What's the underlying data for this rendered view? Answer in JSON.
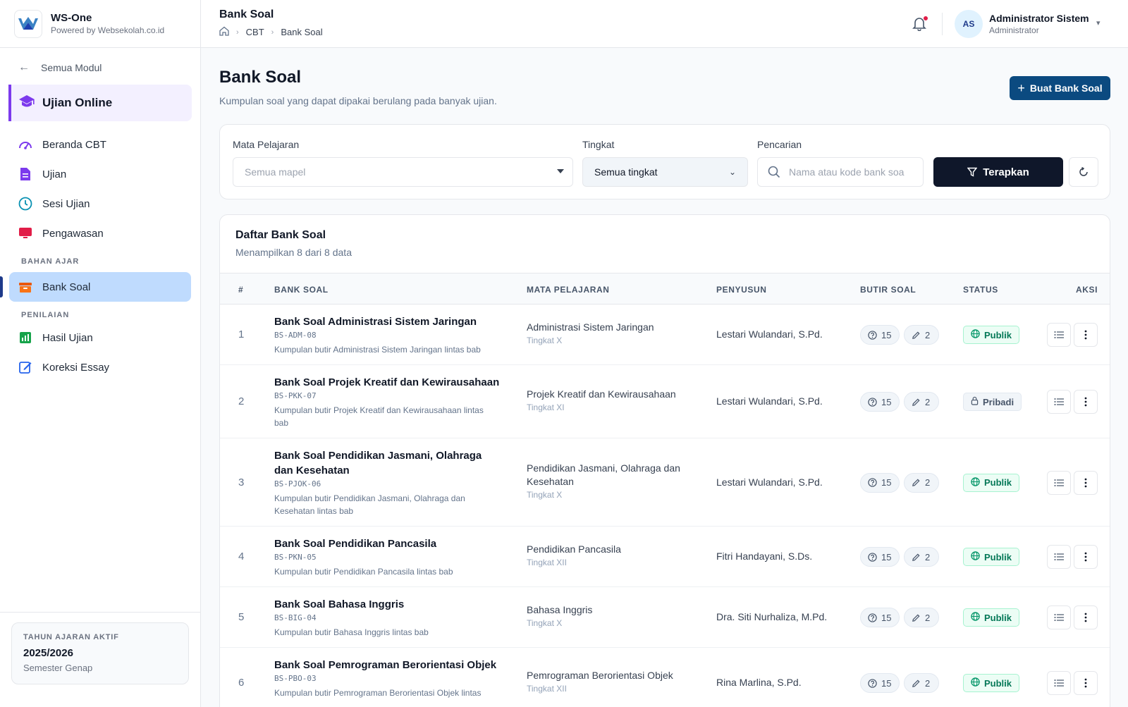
{
  "brand": {
    "name": "WS-One",
    "sub": "Powered by Websekolah.co.id"
  },
  "sidebar": {
    "back_label": "Semua Modul",
    "module_label": "Ujian Online",
    "items": [
      {
        "label": "Beranda CBT",
        "icon": "dashboard-icon"
      },
      {
        "label": "Ujian",
        "icon": "document-icon"
      },
      {
        "label": "Sesi Ujian",
        "icon": "clock-icon"
      },
      {
        "label": "Pengawasan",
        "icon": "monitor-icon"
      }
    ],
    "section_bahan": "BAHAN AJAR",
    "bank_soal_label": "Bank Soal",
    "section_penilaian": "PENILAIAN",
    "penilaian_items": [
      {
        "label": "Hasil Ujian",
        "icon": "chart-icon"
      },
      {
        "label": "Koreksi Essay",
        "icon": "edit-icon"
      }
    ],
    "footer": {
      "label": "TAHUN AJARAN AKTIF",
      "year": "2025/2026",
      "semester": "Semester Genap"
    }
  },
  "topbar": {
    "title": "Bank Soal",
    "breadcrumb": [
      "CBT",
      "Bank Soal"
    ],
    "user": {
      "initials": "AS",
      "name": "Administrator Sistem",
      "role": "Administrator"
    }
  },
  "page": {
    "title": "Bank Soal",
    "subtitle": "Kumpulan soal yang dapat dipakai berulang pada banyak ujian.",
    "create_label": "Buat Bank Soal"
  },
  "filters": {
    "mapel_label": "Mata Pelajaran",
    "mapel_value": "Semua mapel",
    "tingkat_label": "Tingkat",
    "tingkat_value": "Semua tingkat",
    "search_label": "Pencarian",
    "search_placeholder": "Nama atau kode bank soa",
    "apply_label": "Terapkan"
  },
  "table": {
    "title": "Daftar Bank Soal",
    "subtitle": "Menampilkan 8 dari 8 data",
    "headers": [
      "#",
      "BANK SOAL",
      "MATA PELAJARAN",
      "PENYUSUN",
      "BUTIR SOAL",
      "STATUS",
      "AKSI"
    ],
    "rows": [
      {
        "no": "1",
        "title": "Bank Soal Administrasi Sistem Jaringan",
        "code": "BS-ADM-08",
        "desc": "Kumpulan butir Administrasi Sistem Jaringan lintas bab",
        "mapel": "Administrasi Sistem Jaringan",
        "tingkat": "Tingkat X",
        "penyusun": "Lestari Wulandari, S.Pd.",
        "questions": "15",
        "essays": "2",
        "status": "Publik"
      },
      {
        "no": "2",
        "title": "Bank Soal Projek Kreatif dan Kewirausahaan",
        "code": "BS-PKK-07",
        "desc": "Kumpulan butir Projek Kreatif dan Kewirausahaan lintas bab",
        "mapel": "Projek Kreatif dan Kewirausahaan",
        "tingkat": "Tingkat XI",
        "penyusun": "Lestari Wulandari, S.Pd.",
        "questions": "15",
        "essays": "2",
        "status": "Pribadi"
      },
      {
        "no": "3",
        "title": "Bank Soal Pendidikan Jasmani, Olahraga dan Kesehatan",
        "code": "BS-PJOK-06",
        "desc": "Kumpulan butir Pendidikan Jasmani, Olahraga dan Kesehatan lintas bab",
        "mapel": "Pendidikan Jasmani, Olahraga dan Kesehatan",
        "tingkat": "Tingkat X",
        "penyusun": "Lestari Wulandari, S.Pd.",
        "questions": "15",
        "essays": "2",
        "status": "Publik"
      },
      {
        "no": "4",
        "title": "Bank Soal Pendidikan Pancasila",
        "code": "BS-PKN-05",
        "desc": "Kumpulan butir Pendidikan Pancasila lintas bab",
        "mapel": "Pendidikan Pancasila",
        "tingkat": "Tingkat XII",
        "penyusun": "Fitri Handayani, S.Ds.",
        "questions": "15",
        "essays": "2",
        "status": "Publik"
      },
      {
        "no": "5",
        "title": "Bank Soal Bahasa Inggris",
        "code": "BS-BIG-04",
        "desc": "Kumpulan butir Bahasa Inggris lintas bab",
        "mapel": "Bahasa Inggris",
        "tingkat": "Tingkat X",
        "penyusun": "Dra. Siti Nurhaliza, M.Pd.",
        "questions": "15",
        "essays": "2",
        "status": "Publik"
      },
      {
        "no": "6",
        "title": "Bank Soal Pemrograman Berorientasi Objek",
        "code": "BS-PBO-03",
        "desc": "Kumpulan butir Pemrograman Berorientasi Objek lintas",
        "mapel": "Pemrograman Berorientasi Objek",
        "tingkat": "Tingkat XII",
        "penyusun": "Rina Marlina, S.Pd.",
        "questions": "15",
        "essays": "2",
        "status": "Publik"
      }
    ]
  }
}
